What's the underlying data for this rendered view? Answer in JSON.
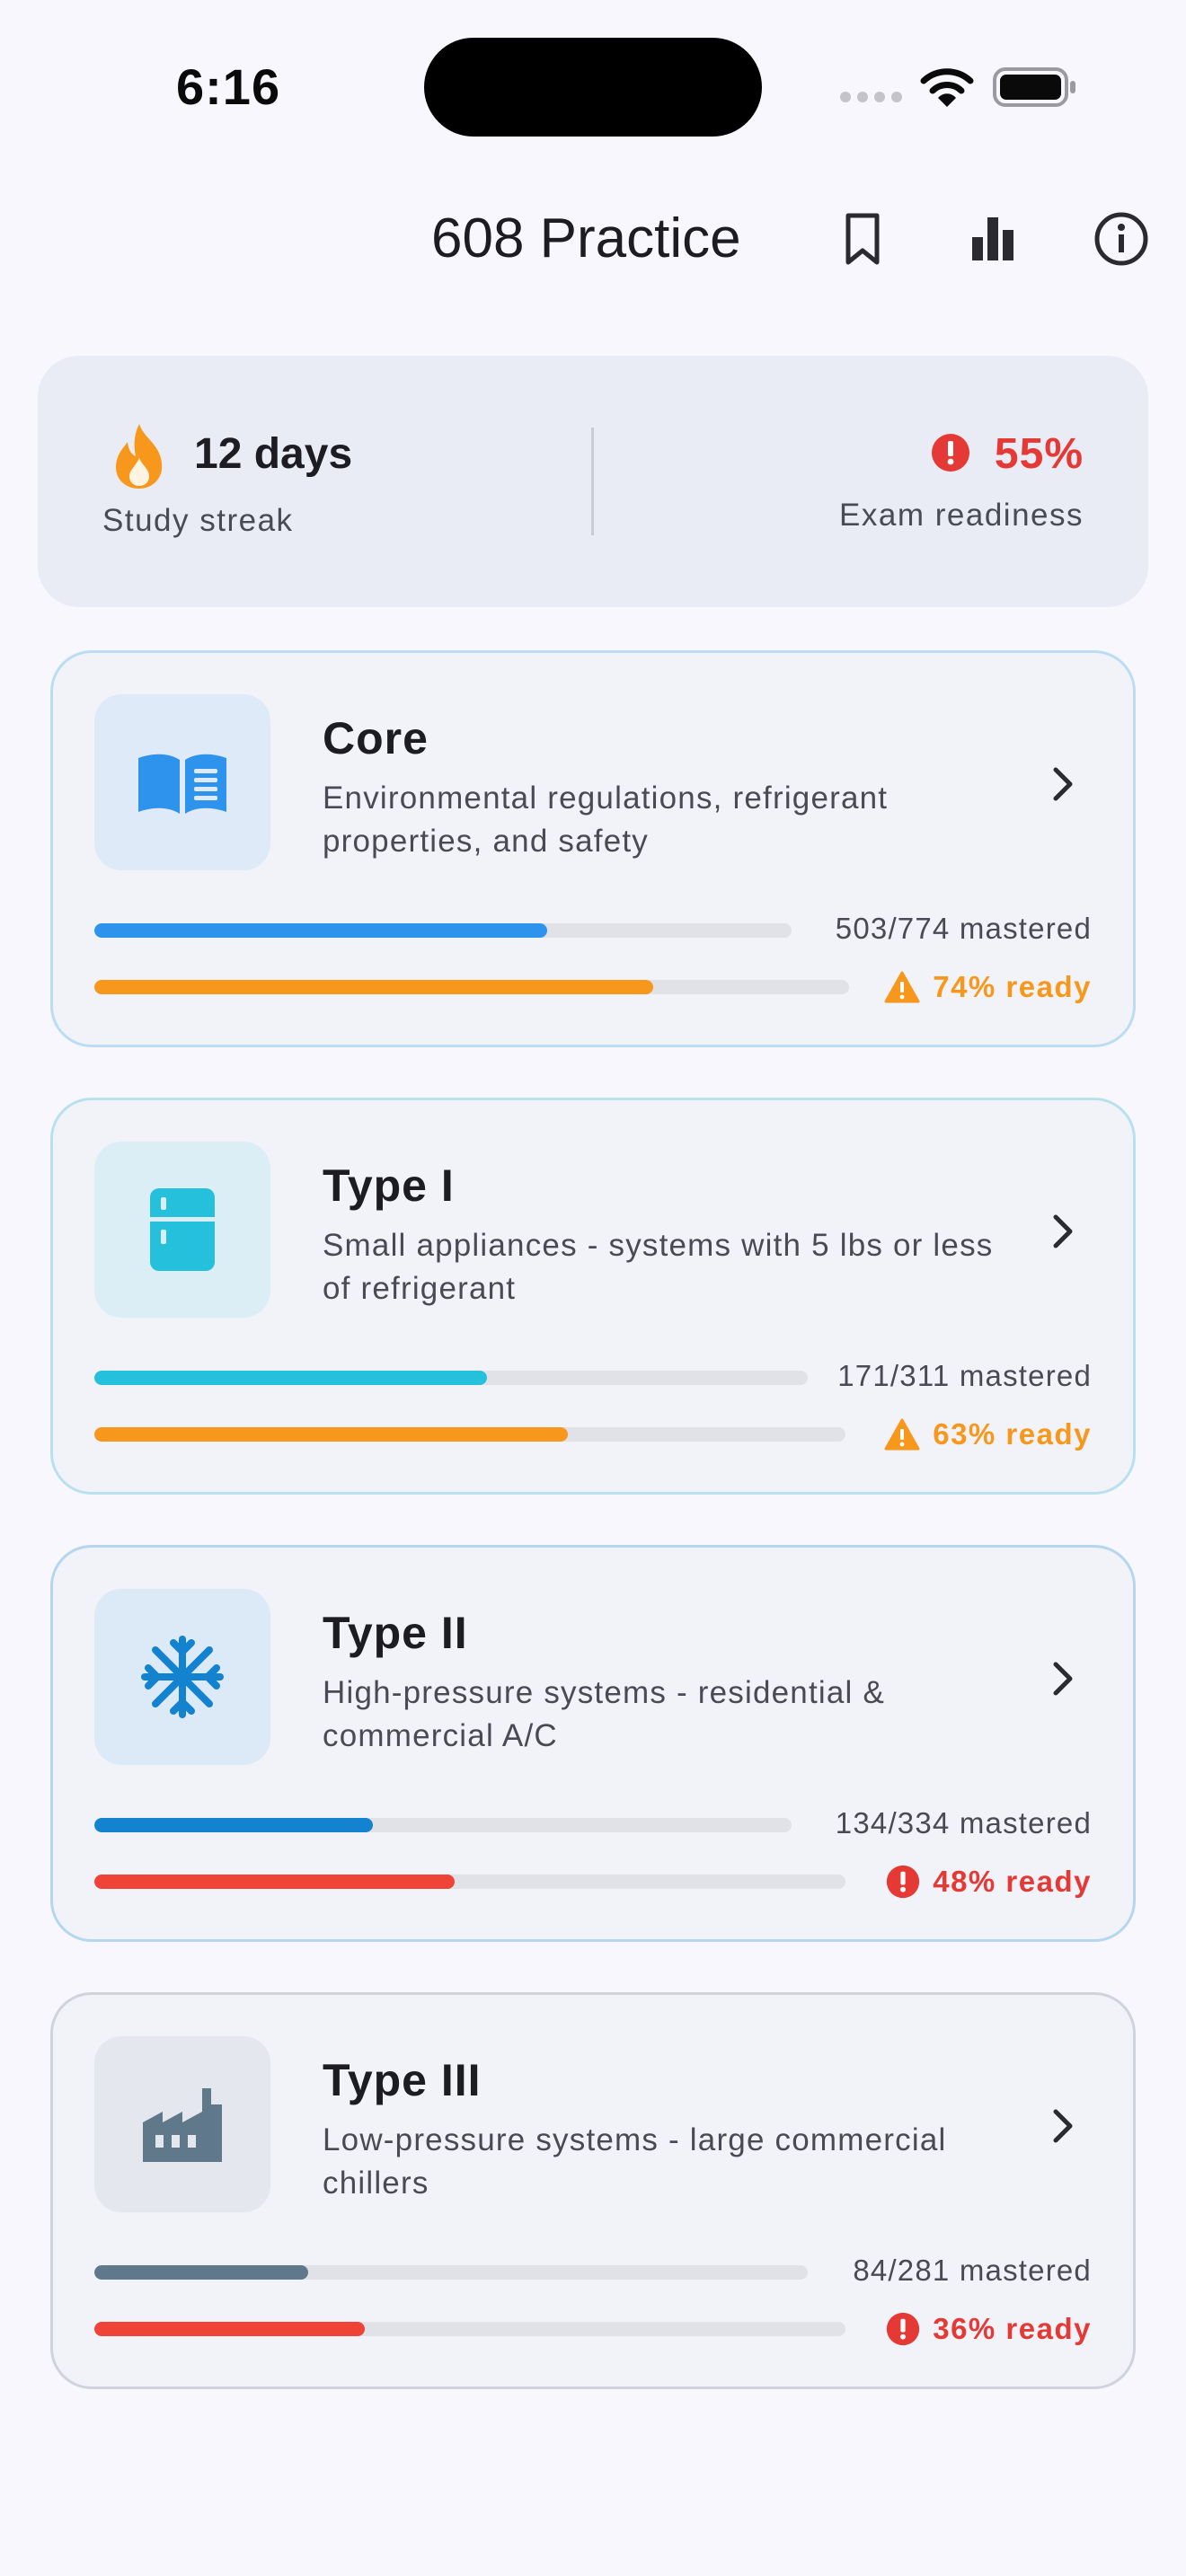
{
  "status_bar": {
    "time": "6:16"
  },
  "header": {
    "title": "608 Practice"
  },
  "summary": {
    "streak_value": "12 days",
    "streak_label": "Study streak",
    "readiness_value": "55%",
    "readiness_label": "Exam readiness"
  },
  "colors": {
    "orange": "#f7971c",
    "red": "#e53935",
    "blue": "#2e93ec",
    "cyan": "#25c0db",
    "dark_blue": "#1383d0",
    "slate": "#60798a"
  },
  "cards": [
    {
      "title": "Core",
      "description": "Environmental regulations, refrigerant properties, and safety",
      "icon": "book-icon",
      "mastered_text": "503/774 mastered",
      "mastered_fraction": 0.65,
      "ready_text": "74% ready",
      "ready_percent": 74,
      "status": "warning"
    },
    {
      "title": "Type I",
      "description": "Small appliances - systems with 5 lbs or less of refrigerant",
      "icon": "fridge-icon",
      "mastered_text": "171/311 mastered",
      "mastered_fraction": 0.55,
      "ready_text": "63% ready",
      "ready_percent": 63,
      "status": "warning"
    },
    {
      "title": "Type II",
      "description": "High-pressure systems - residential & commercial A/C",
      "icon": "snowflake-icon",
      "mastered_text": "134/334 mastered",
      "mastered_fraction": 0.4,
      "ready_text": "48% ready",
      "ready_percent": 48,
      "status": "error"
    },
    {
      "title": "Type III",
      "description": "Low-pressure systems - large commercial chillers",
      "icon": "factory-icon",
      "mastered_text": "84/281 mastered",
      "mastered_fraction": 0.3,
      "ready_text": "36% ready",
      "ready_percent": 36,
      "status": "error"
    }
  ]
}
